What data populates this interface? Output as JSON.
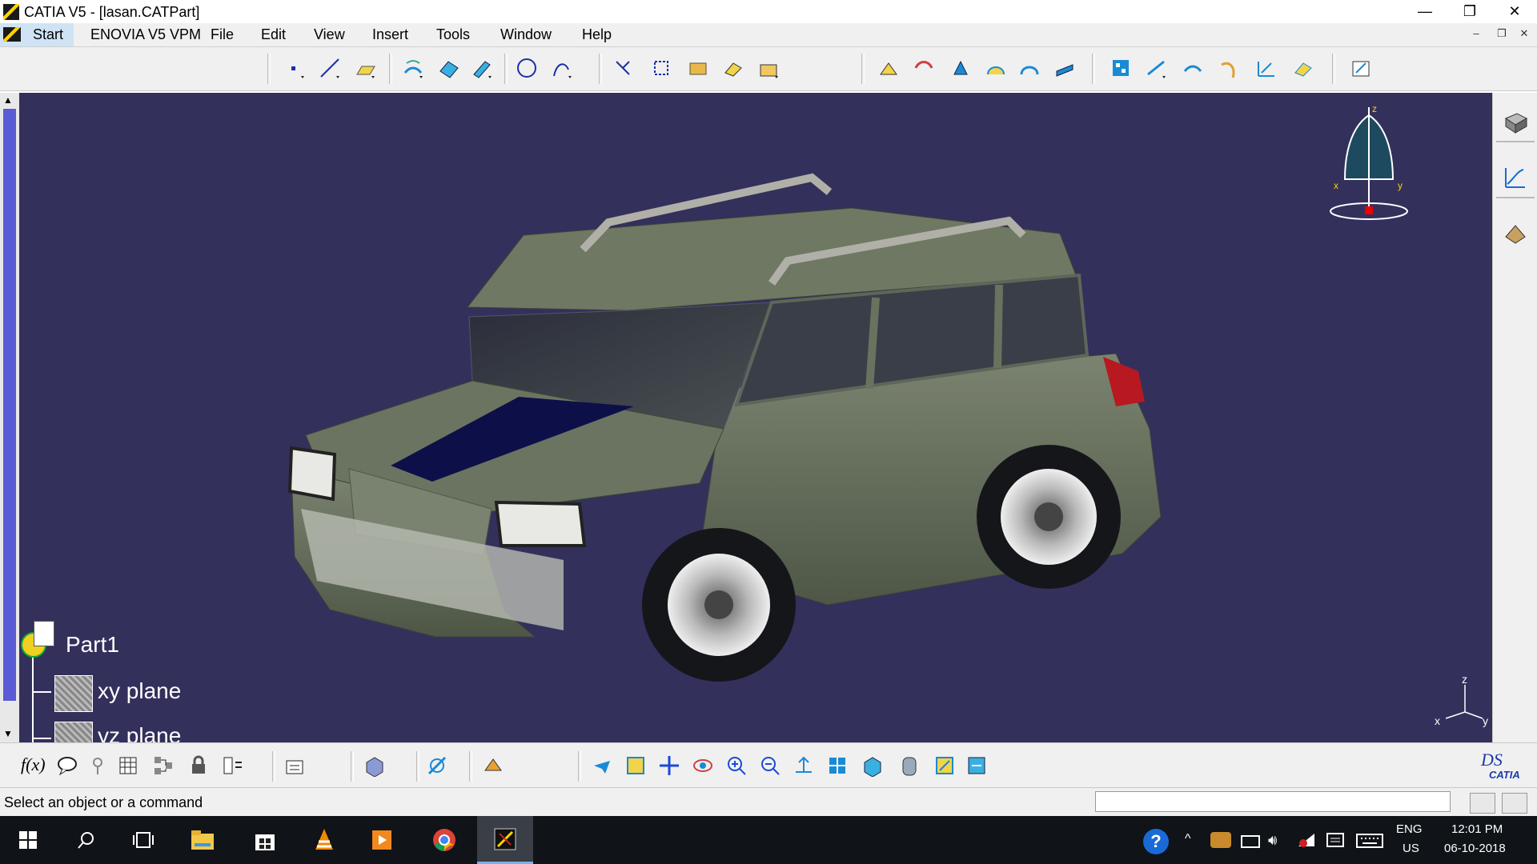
{
  "window": {
    "title": "CATIA V5 - [lasan.CATPart]",
    "controls": {
      "minimize": "—",
      "restore": "❐",
      "close": "✕"
    }
  },
  "menubar": {
    "items": [
      "Start",
      "ENOVIA V5 VPM",
      "File",
      "Edit",
      "View",
      "Insert",
      "Tools",
      "Window",
      "Help"
    ]
  },
  "tree": {
    "root": "Part1",
    "items": [
      "xy plane",
      "yz plane"
    ]
  },
  "compass": {
    "z": "z",
    "x": "x",
    "y": "y"
  },
  "axis_triad": {
    "z": "z",
    "x": "x",
    "y": "y"
  },
  "logo": {
    "text": "CATIA"
  },
  "bottom_toolbar": {
    "fx_label": "f(x)"
  },
  "status": {
    "prompt": "Select an object or a command",
    "command_value": ""
  },
  "taskbar": {
    "lang_line1": "ENG",
    "lang_line2": "US",
    "time": "12:01 PM",
    "date": "06-10-2018"
  },
  "colors": {
    "viewport_bg": "#33305c",
    "car_body": "#6c7560",
    "hood_stripe": "#0d1048",
    "taskbar_bg": "#101318"
  }
}
